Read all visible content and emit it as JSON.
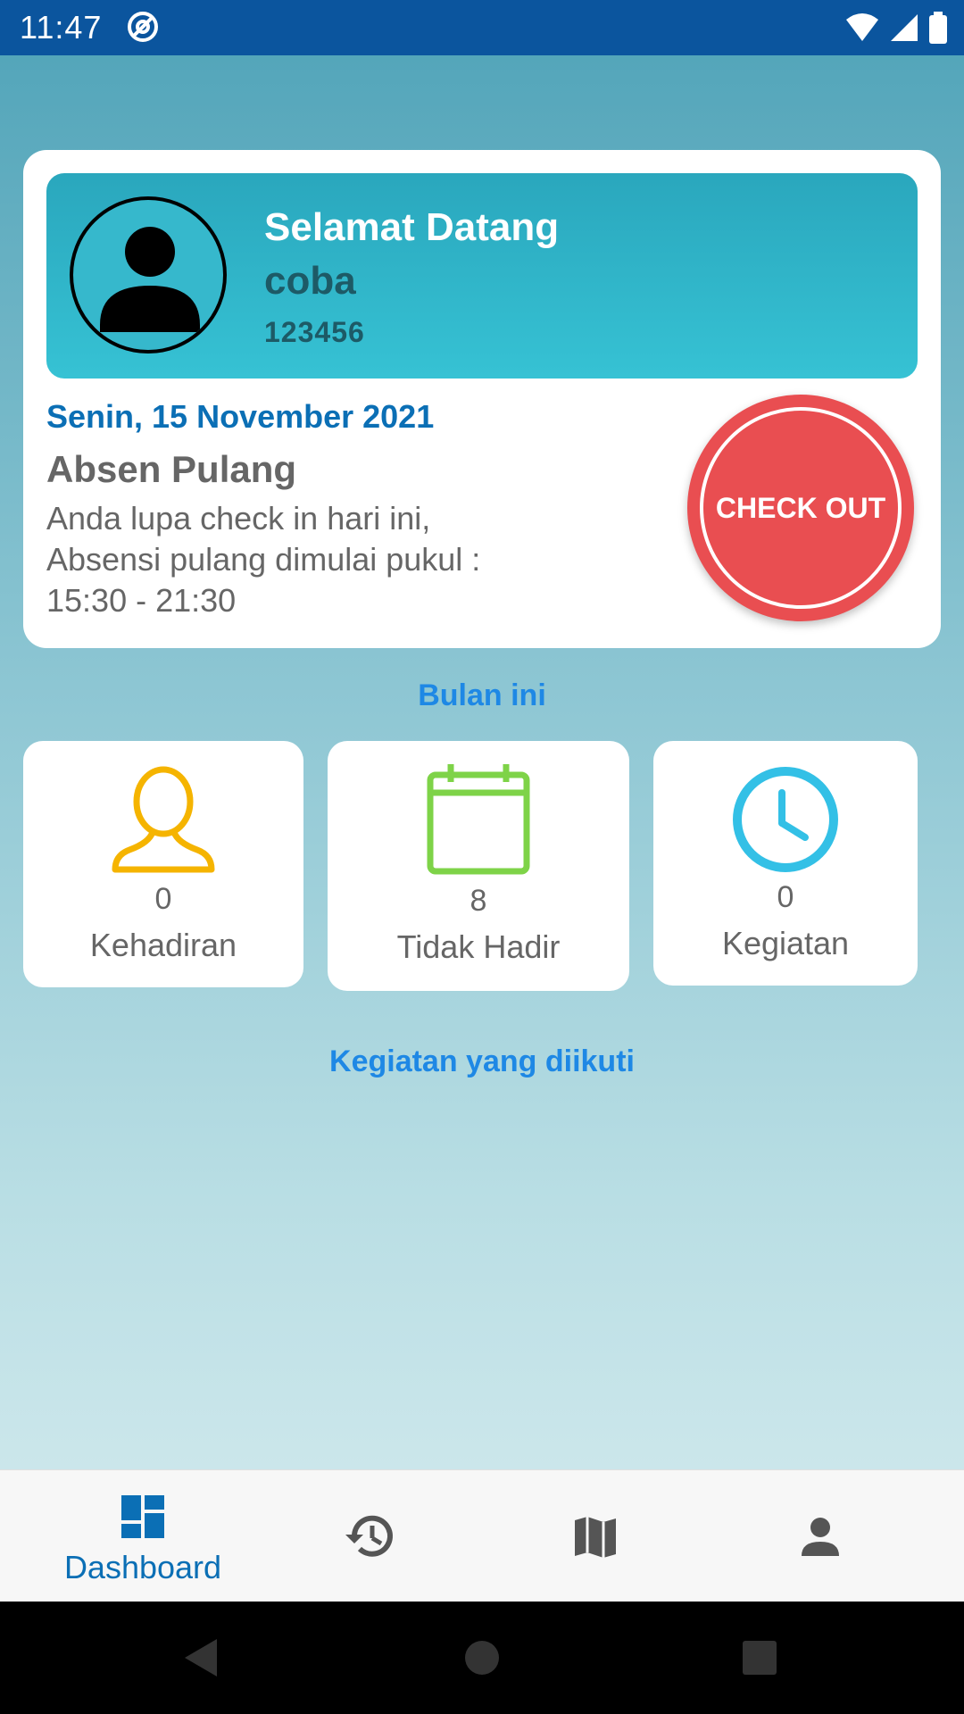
{
  "status_bar": {
    "time": "11:47",
    "background_color": "#0b559e",
    "icons": [
      "at-sign-icon",
      "wifi-icon",
      "cellular-signal-icon",
      "battery-icon"
    ]
  },
  "welcome": {
    "title": "Selamat Datang",
    "name": "coba",
    "id": "123456",
    "avatar_icon": "person-avatar-icon"
  },
  "attendance": {
    "date": "Senin, 15 November 2021",
    "title": "Absen Pulang",
    "description": "Anda lupa check in hari ini, Absensi pulang dimulai pukul : 15:30 - 21:30",
    "checkout_label": "CHECK OUT",
    "checkout_color": "#e94e51"
  },
  "month_section": {
    "label": "Bulan ini"
  },
  "stats": [
    {
      "icon": "person-outline-icon",
      "color": "#f5b400",
      "value": "0",
      "label": "Kehadiran"
    },
    {
      "icon": "calendar-icon",
      "color": "#7ed348",
      "value": "8",
      "label": "Tidak Hadir"
    },
    {
      "icon": "clock-icon",
      "color": "#33c0e6",
      "value": "0",
      "label": "Kegiatan"
    }
  ],
  "activities_section": {
    "label": "Kegiatan yang diikuti"
  },
  "bottom_nav": {
    "items": [
      {
        "icon": "dashboard-icon",
        "label": "Dashboard",
        "active": true
      },
      {
        "icon": "history-icon",
        "label": "",
        "active": false
      },
      {
        "icon": "map-icon",
        "label": "",
        "active": false
      },
      {
        "icon": "profile-icon",
        "label": "",
        "active": false
      }
    ],
    "active_color": "#0b6fb5"
  },
  "system_nav": {
    "buttons": [
      "back-icon",
      "home-icon",
      "recents-icon"
    ]
  }
}
